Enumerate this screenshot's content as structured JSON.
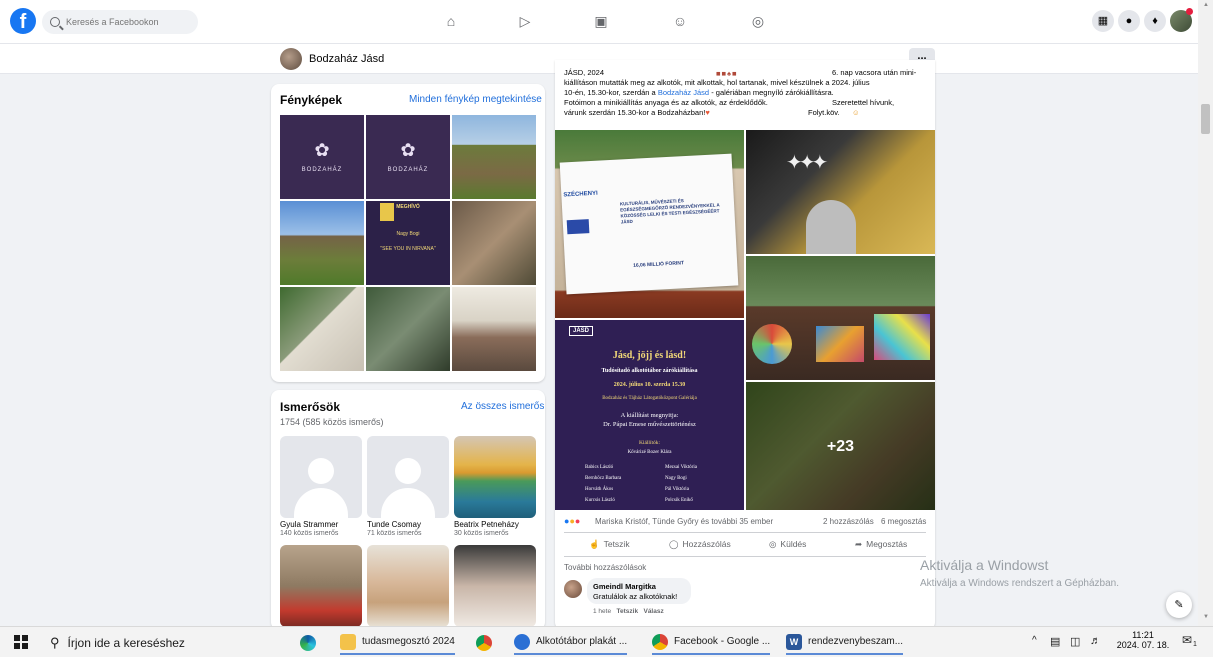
{
  "topbar": {
    "logo": "f",
    "search_placeholder": "Keresés a Facebookon",
    "nav_icons": [
      "home-icon",
      "video-icon",
      "marketplace-icon",
      "groups-icon",
      "gaming-icon"
    ],
    "right_icons": [
      "menu-grid-icon",
      "messenger-icon",
      "notifications-icon",
      "profile-avatar"
    ]
  },
  "subheader": {
    "name": "Bodzaház Jásd",
    "more": "..."
  },
  "photos": {
    "title": "Fényképek",
    "see_all": "Minden fénykép megtekintése",
    "logo_text": "BODZAHÁZ",
    "invite_title": "MEGHÍVÓ",
    "invite_lines": [
      "Nagy Bogi",
      "\"SEE YOU IN NIRVANA\""
    ]
  },
  "friends": {
    "title": "Ismerősök",
    "see_all": "Az összes ismerős",
    "count": "1754 (585 közös ismerős)",
    "items": [
      {
        "name": "Gyula Strammer",
        "mutual": "140 közös ismerős"
      },
      {
        "name": "Tunde Csomay",
        "mutual": "71 közös ismerős"
      },
      {
        "name": "Beatrix Petneházy",
        "mutual": "30 közös ismerős"
      }
    ]
  },
  "post": {
    "line1_left": "JÁSD, 2024",
    "line1_right": "6. nap vacsora után mini-",
    "line2": "kiállításon mutatták meg az alkotók, mit alkottak, hol tartanak, mivel készülnek a 2024. július",
    "line3_a": "10-én, 15.30-kor, szerdán a ",
    "line3_link": "Bodzaház Jásd",
    "line3_b": " - galériában megnyíló zárókiállításra.",
    "line4_left": "Fotóimon a minikiállítás anyaga és az alkotók, az érdeklődők.",
    "line4_right": "Szeretettel hívunk,",
    "line5_left": "várunk szerdán 15.30-kor a Bodzaházban!",
    "line5_right": "Folyt.köv.",
    "sign": {
      "brand": "SZÉCHENYI",
      "title": "KULTURÁLIS, MŰVÉSZETI ÉS EGÉSZSÉGMEGŐRZŐ RENDEZVÉNYEKKEL A KÖZÖSSÉG LELKI ÉS TESTI EGÉSZSÉGÉÉRT JÁSD",
      "amount": "16,06 MILLIÓ FORINT"
    },
    "poster": {
      "logo": "JÁSD",
      "title": "Jásd, jöjj és lásd!",
      "subtitle": "Tudósítadó alkotótábor zárókiállítása",
      "date": "2024. július 10. szerda 15.30",
      "venue": "Bodzaház és Tájház Látogatóközpont Galériája",
      "opening": "A kiállítást megnyitja:",
      "opener": "Dr. Pápai Emese művészettörténész",
      "exhibitors_label": "Kiállítók:",
      "lead": "Kővárizé Bozer Klára",
      "col1": [
        "Babics László",
        "Bernhöcz Barbara",
        "Horváth Ákos",
        "Kurcsis László"
      ],
      "col2": [
        "Mezsai Viktória",
        "Nagy Bogi",
        "Pál Viktória",
        "Polcsik Enikő"
      ]
    },
    "more_photos": "+23",
    "reactions": "Mariska Kristóf, Tünde Győry és további 35 ember",
    "comments_count": "2 hozzászólás",
    "shares_count": "6 megosztás",
    "actions": [
      "Tetszik",
      "Hozzászólás",
      "Küldés",
      "Megosztás"
    ],
    "more_comments": "További hozzászólások",
    "comment": {
      "author": "Gmeindl Margitka",
      "text": "Gratulálok az alkotóknak!",
      "time": "1 hete",
      "like": "Tetszik",
      "reply": "Válasz"
    }
  },
  "watermark": {
    "line1": "Aktiválja a Windowst",
    "line2": "Aktiválja a Windows rendszert a Gépházban."
  },
  "taskbar": {
    "search": "Írjon ide a kereséshez",
    "items": [
      "tudasmegosztó 2024",
      "Alkotótábor plakát ...",
      "Facebook - Google ...",
      "rendezvenybeszam..."
    ],
    "time": "11:21",
    "date": "2024. 07. 18.",
    "notif_count": "1"
  }
}
